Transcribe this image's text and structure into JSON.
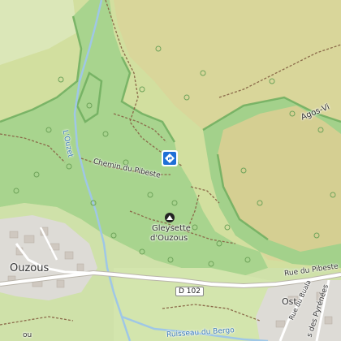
{
  "map": {
    "place_labels": {
      "ouzous": "Ouzous",
      "ost": "Ost",
      "agos_vi": "Agos-Vi",
      "bergo": "Ruisseau du Bergo"
    },
    "road_labels": {
      "chemin_pibeste": "Chemin du Pibeste",
      "rue_pibeste": "Rue du Pibeste",
      "rue_buala": "Rue du Buala",
      "rue_pyrenees": "s des Pyrénées",
      "d102": "D 102"
    },
    "water_labels": {
      "ouzet": "L'Ouzet"
    },
    "peak": {
      "line1": "Gleysette",
      "line2": "d'Ouzous"
    },
    "edge_fragment": "ou",
    "colors": {
      "forest": "#9cd084",
      "forest_dark": "#7fbf6b",
      "scrub": "#c9dfa4",
      "meadow": "#cfe1a9",
      "grass_light": "#e0ecc4",
      "heath": "#d7d49a",
      "residential": "#e0dfdb",
      "water": "#9fc7e6",
      "road": "#ffffff",
      "path": "#8b6a4a",
      "boundary": "#6aa05a",
      "marker_blue": "#1f6fd6"
    },
    "icons": {
      "marker": "direction-sign-icon",
      "peak": "peak-icon",
      "tree": "tree-icon"
    }
  }
}
